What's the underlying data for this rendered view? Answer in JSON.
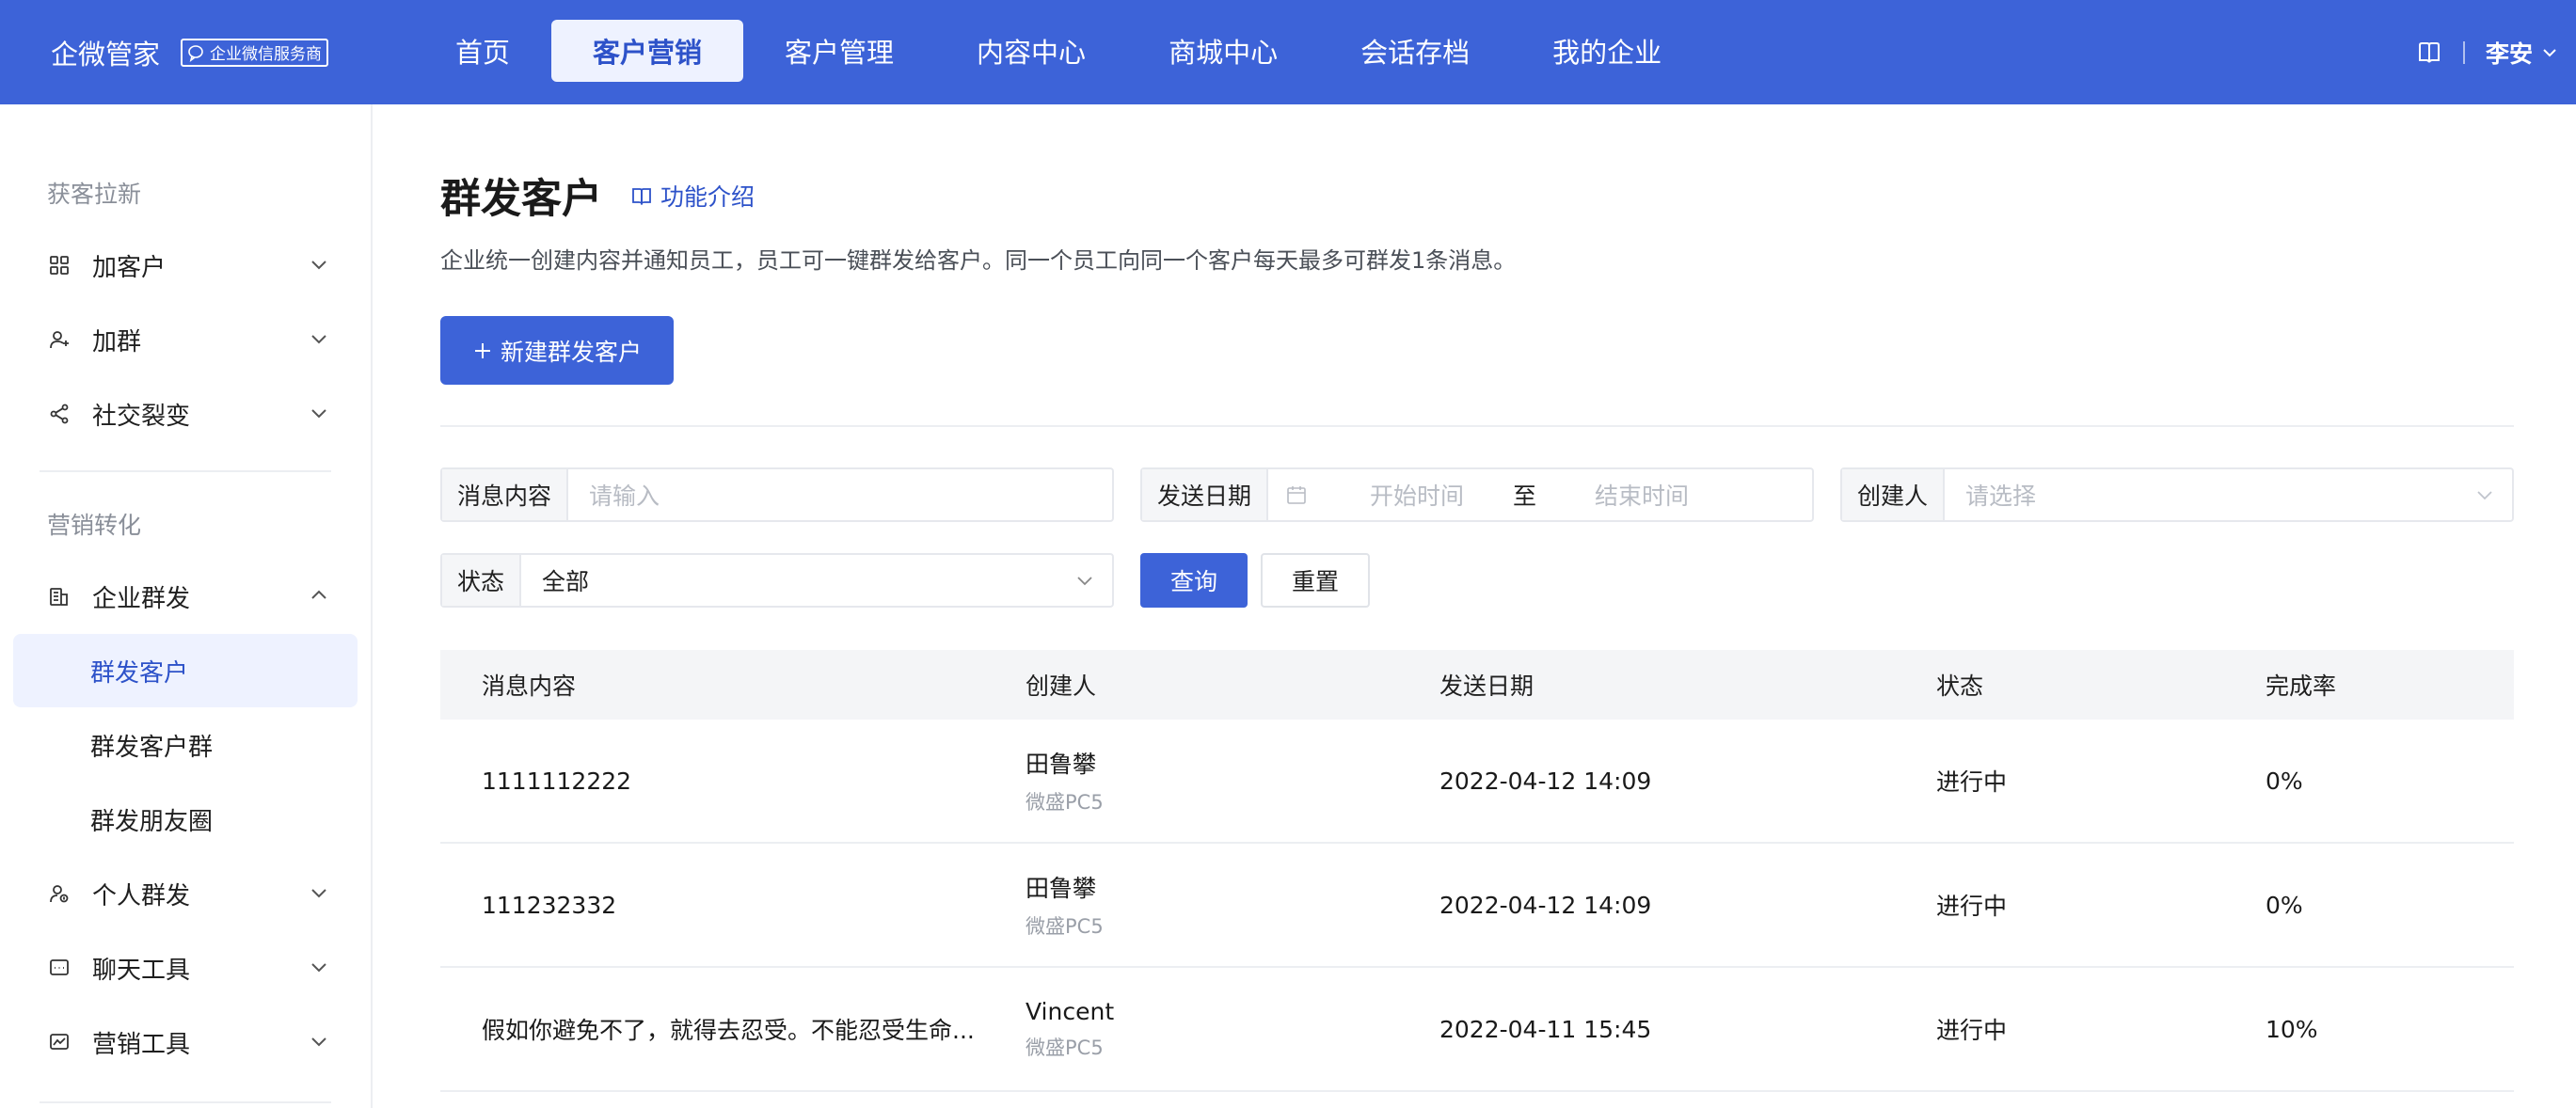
{
  "topbar": {
    "brand": "企微管家",
    "badge": "企业微信服务商",
    "nav": [
      "首页",
      "客户营销",
      "客户管理",
      "内容中心",
      "商城中心",
      "会话存档",
      "我的企业"
    ],
    "active_nav": "客户营销",
    "user": "李安",
    "accent": "#3d63d8"
  },
  "sidebar": {
    "section1": "获客拉新",
    "group1": [
      {
        "label": "加客户",
        "icon": "grid-icon"
      },
      {
        "label": "加群",
        "icon": "user-add-icon"
      },
      {
        "label": "社交裂变",
        "icon": "share-icon"
      }
    ],
    "section2": "营销转化",
    "expanded": {
      "label": "企业群发",
      "icon": "building-icon"
    },
    "subitems": [
      "群发客户",
      "群发客户群",
      "群发朋友圈"
    ],
    "active_sub": "群发客户",
    "group2": [
      {
        "label": "个人群发",
        "icon": "person-icon"
      },
      {
        "label": "聊天工具",
        "icon": "chat-icon"
      },
      {
        "label": "营销工具",
        "icon": "chart-icon"
      }
    ]
  },
  "main": {
    "title": "群发客户",
    "intro_link": "功能介绍",
    "description": "企业统一创建内容并通知员工，员工可一键群发给客户。同一个员工向同一个客户每天最多可群发1条消息。",
    "new_button": "新建群发客户"
  },
  "filters": {
    "content_label": "消息内容",
    "content_placeholder": "请输入",
    "date_label": "发送日期",
    "date_start": "开始时间",
    "date_to": "至",
    "date_end": "结束时间",
    "creator_label": "创建人",
    "creator_placeholder": "请选择",
    "status_label": "状态",
    "status_value": "全部",
    "query": "查询",
    "reset": "重置"
  },
  "table": {
    "columns": [
      "消息内容",
      "创建人",
      "发送日期",
      "状态",
      "完成率"
    ],
    "rows": [
      {
        "content": "1111112222",
        "creator": "田鲁攀",
        "creator_sub": "微盛PC5",
        "date": "2022-04-12 14:09",
        "status": "进行中",
        "rate": "0%"
      },
      {
        "content": "111232332",
        "creator": "田鲁攀",
        "creator_sub": "微盛PC5",
        "date": "2022-04-12 14:09",
        "status": "进行中",
        "rate": "0%"
      },
      {
        "content": "假如你避免不了，就得去忍受。不能忍受生命...",
        "creator": "Vincent",
        "creator_sub": "微盛PC5",
        "date": "2022-04-11 15:45",
        "status": "进行中",
        "rate": "10%"
      }
    ]
  }
}
